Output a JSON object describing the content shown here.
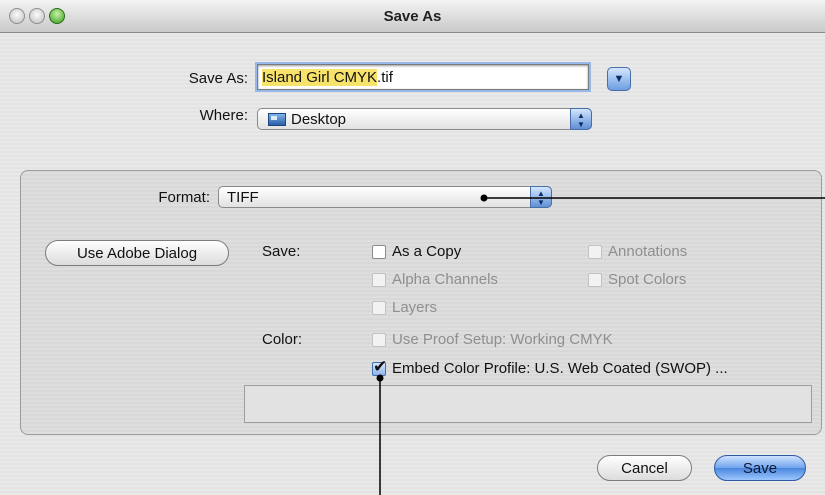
{
  "window": {
    "title": "Save As"
  },
  "save_as": {
    "label": "Save As:",
    "filename_highlighted": "Island Girl CMYK",
    "filename_extension": ".tif"
  },
  "where": {
    "label": "Where:",
    "value": "Desktop"
  },
  "format": {
    "label": "Format:",
    "value": "TIFF"
  },
  "adobe_dialog_button": "Use Adobe Dialog",
  "save_section": {
    "label": "Save:",
    "options": {
      "as_a_copy": {
        "label": "As a Copy",
        "checked": false,
        "enabled": true
      },
      "annotations": {
        "label": "Annotations",
        "checked": false,
        "enabled": false
      },
      "alpha_channels": {
        "label": "Alpha Channels",
        "checked": false,
        "enabled": false
      },
      "spot_colors": {
        "label": "Spot Colors",
        "checked": false,
        "enabled": false
      },
      "layers": {
        "label": "Layers",
        "checked": false,
        "enabled": false
      }
    }
  },
  "color_section": {
    "label": "Color:",
    "use_proof_setup": {
      "label": "Use Proof Setup:  Working CMYK",
      "checked": false,
      "enabled": false
    },
    "embed_profile": {
      "label": "Embed Color Profile:  U.S. Web Coated (SWOP) ...",
      "checked": true,
      "enabled": true
    }
  },
  "buttons": {
    "cancel": "Cancel",
    "save": "Save"
  }
}
